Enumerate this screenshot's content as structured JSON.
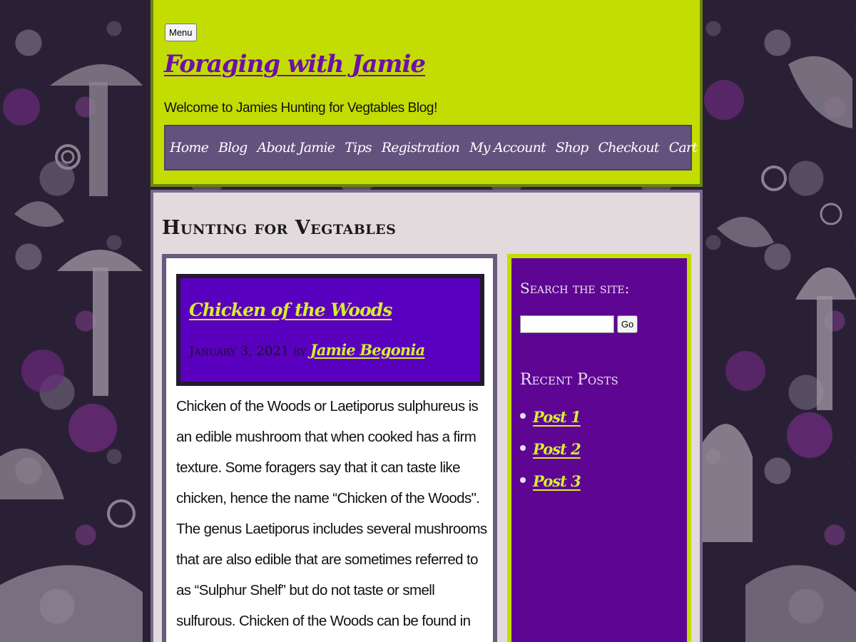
{
  "header": {
    "menu_label": "Menu",
    "site_title": "Foraging with Jamie",
    "tagline": "Welcome to Jamies Hunting for Vegtables Blog!"
  },
  "nav": {
    "items": [
      {
        "label": "Home"
      },
      {
        "label": "Blog"
      },
      {
        "label": "About Jamie"
      },
      {
        "label": "Tips"
      },
      {
        "label": "Registration"
      },
      {
        "label": "My Account"
      },
      {
        "label": "Shop"
      },
      {
        "label": "Checkout"
      },
      {
        "label": "Cart"
      }
    ]
  },
  "page": {
    "title": "Hunting for Vegtables"
  },
  "post": {
    "title": "Chicken of the Woods",
    "date": "January 3, 2021",
    "by": "by",
    "author": "Jamie Begonia",
    "body": "Chicken of the Woods or Laetiporus sulphureus is an edible mushroom that when cooked has a firm texture. Some foragers say that it can taste like chicken, hence the name “Chicken of the Woods\". The genus Laetiporus includes several mushrooms that are also edible that are sometimes referred to as “Sulphur Shelf” but do not taste or smell sulfurous. Chicken of the Woods can be found in the forests of Western"
  },
  "sidebar": {
    "search_title": "Search the site:",
    "search_value": "",
    "search_button": "Go",
    "recent_title": "Recent Posts",
    "recent_posts": [
      {
        "label": "Post 1"
      },
      {
        "label": "Post 2"
      },
      {
        "label": "Post 3"
      }
    ]
  },
  "colors": {
    "header_bg": "#c3dc02",
    "nav_bg": "#64527e",
    "content_bg": "#e2dadd",
    "entry_header_bg": "#5a00bf",
    "sidebar_bg": "#5e0693",
    "link_color": "#d6ec32",
    "title_color": "#6e0fa8"
  }
}
